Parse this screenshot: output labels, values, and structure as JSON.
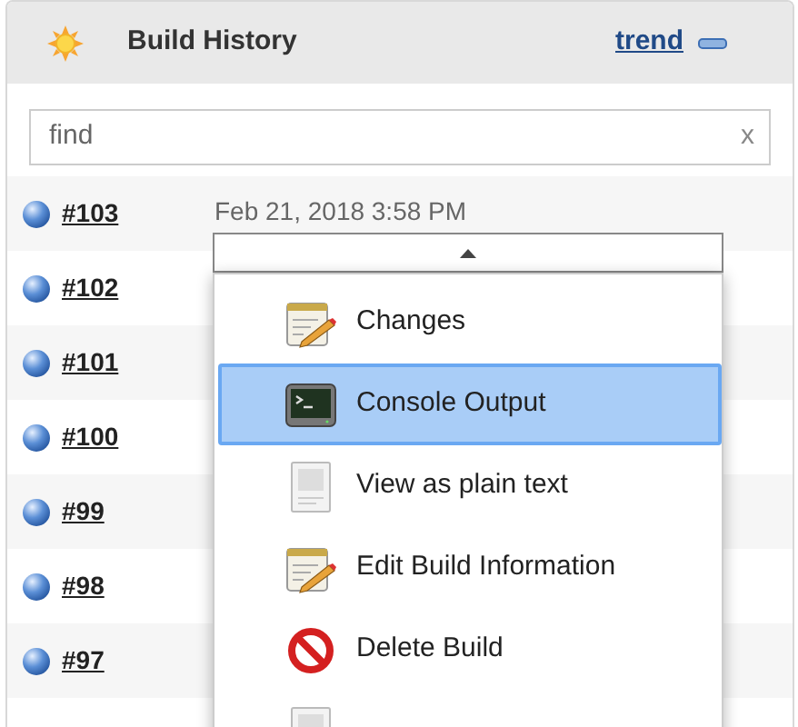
{
  "panel": {
    "title": "Build History",
    "trend_link": "trend"
  },
  "search": {
    "placeholder": "find",
    "clear": "x"
  },
  "builds": [
    {
      "number": "#103",
      "date": "Feb 21, 2018 3:58 PM"
    },
    {
      "number": "#102"
    },
    {
      "number": "#101"
    },
    {
      "number": "#100"
    },
    {
      "number": "#99"
    },
    {
      "number": "#98"
    },
    {
      "number": "#97"
    }
  ],
  "menu": {
    "items": [
      {
        "kind": "notepad",
        "label": "Changes",
        "selected": false
      },
      {
        "kind": "terminal",
        "label": "Console Output",
        "selected": true
      },
      {
        "kind": "document",
        "label": "View as plain text",
        "selected": false
      },
      {
        "kind": "notepad",
        "label": "Edit Build Information",
        "selected": false
      },
      {
        "kind": "forbidden",
        "label": "Delete Build",
        "selected": false
      },
      {
        "kind": "document",
        "selected": false
      }
    ]
  }
}
